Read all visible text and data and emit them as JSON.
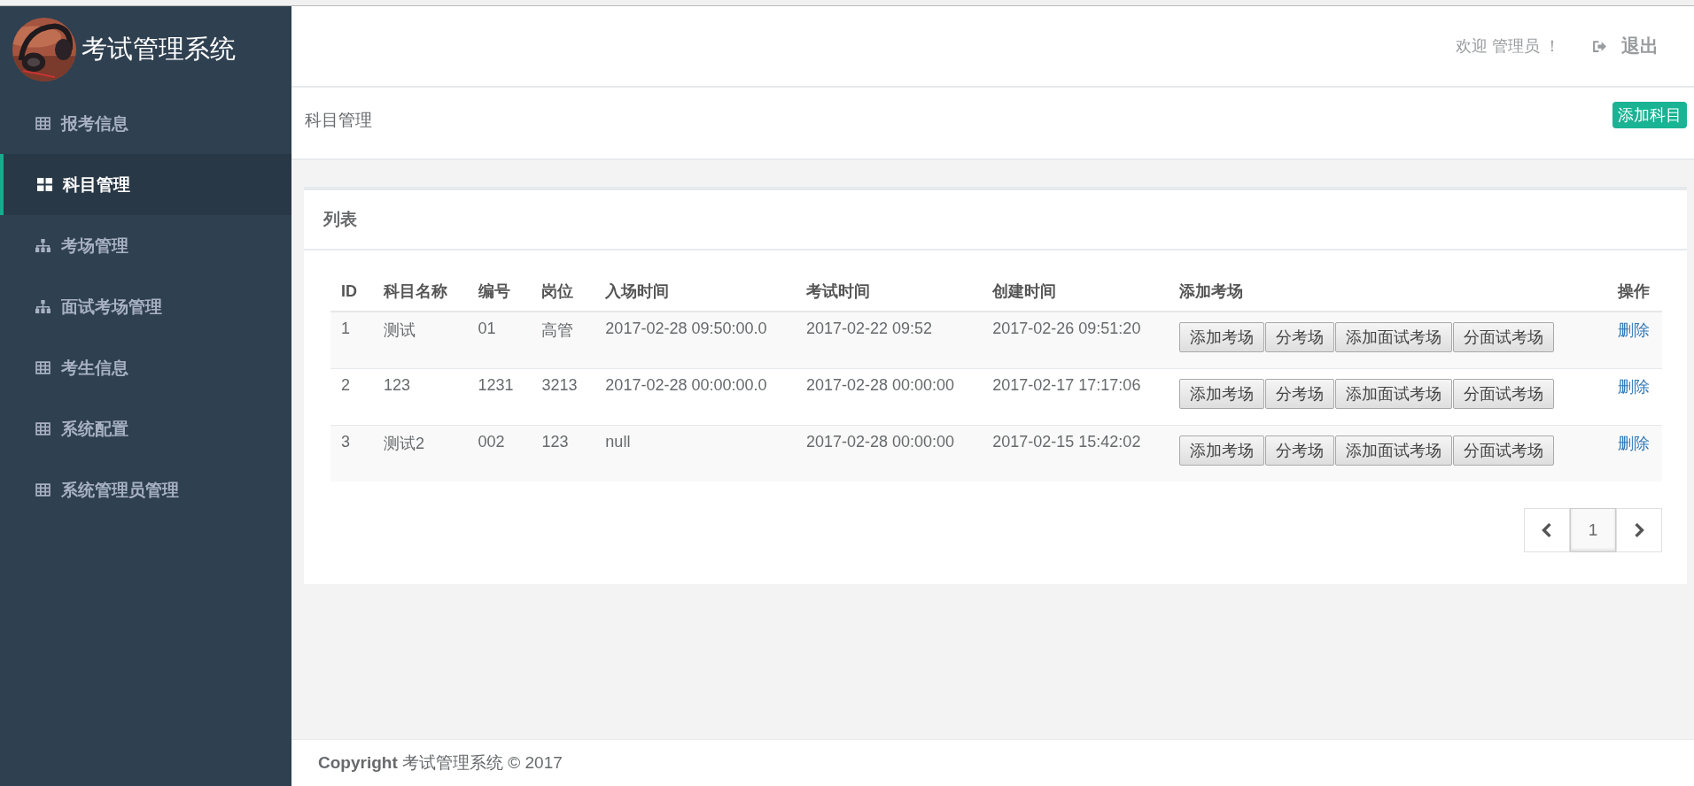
{
  "brand": {
    "title": "考试管理系统"
  },
  "sidebar": {
    "items": [
      {
        "label": "报考信息",
        "kind": "grid",
        "selected": false
      },
      {
        "label": "科目管理",
        "kind": "tiles",
        "selected": true
      },
      {
        "label": "考场管理",
        "kind": "tree",
        "selected": false
      },
      {
        "label": "面试考场管理",
        "kind": "tree",
        "selected": false
      },
      {
        "label": "考生信息",
        "kind": "grid",
        "selected": false
      },
      {
        "label": "系统配置",
        "kind": "grid",
        "selected": false
      },
      {
        "label": "系统管理员管理",
        "kind": "grid",
        "selected": false
      }
    ]
  },
  "header": {
    "welcome": "欢迎 管理员 ！",
    "logout": "退出"
  },
  "breadcrumb": {
    "title": "科目管理",
    "add_button": "添加科目"
  },
  "panel": {
    "title": "列表",
    "table": {
      "columns": [
        "ID",
        "科目名称",
        "编号",
        "岗位",
        "入场时间",
        "考试时间",
        "创建时间",
        "添加考场",
        "操作"
      ],
      "rows": [
        {
          "cells": [
            "1",
            "测试",
            "01",
            "高管",
            "2017-02-28 09:50:00.0",
            "2017-02-22 09:52",
            "2017-02-26 09:51:20"
          ],
          "actions": [
            "添加考场",
            "分考场",
            "添加面试考场",
            "分面试考场"
          ],
          "delete": "删除"
        },
        {
          "cells": [
            "2",
            "123",
            "1231",
            "3213",
            "2017-02-28 00:00:00.0",
            "2017-02-28 00:00:00",
            "2017-02-17 17:17:06"
          ],
          "actions": [
            "添加考场",
            "分考场",
            "添加面试考场",
            "分面试考场"
          ],
          "delete": "删除"
        },
        {
          "cells": [
            "3",
            "测试2",
            "002",
            "123",
            "null",
            "2017-02-28 00:00:00",
            "2017-02-15 15:42:02"
          ],
          "actions": [
            "添加考场",
            "分考场",
            "添加面试考场",
            "分面试考场"
          ],
          "delete": "删除"
        }
      ]
    },
    "pagination": {
      "pages": [
        {
          "label": "1",
          "selected": true
        }
      ]
    }
  },
  "footer": {
    "text": "**Copyright** 考试管理系统 © 2017"
  }
}
